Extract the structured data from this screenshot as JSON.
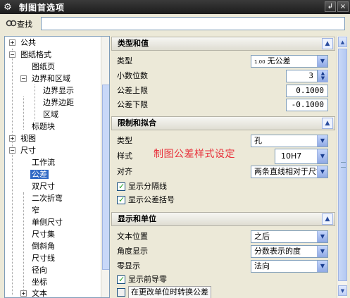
{
  "window": {
    "title": "制图首选项",
    "btn_back": "↲",
    "btn_close": "×"
  },
  "search": {
    "label": "查找",
    "value": ""
  },
  "tree": {
    "items": [
      {
        "label": "公共"
      },
      {
        "label": "图纸格式"
      },
      {
        "label": "图纸页"
      },
      {
        "label": "边界和区域"
      },
      {
        "label": "边界显示"
      },
      {
        "label": "边界边距"
      },
      {
        "label": "区域"
      },
      {
        "label": "标题块"
      },
      {
        "label": "视图"
      },
      {
        "label": "尺寸"
      },
      {
        "label": "工作流"
      },
      {
        "label": "公差"
      },
      {
        "label": "双尺寸"
      },
      {
        "label": "二次折弯"
      },
      {
        "label": "窄"
      },
      {
        "label": "单侧尺寸"
      },
      {
        "label": "尺寸集"
      },
      {
        "label": "倒斜角"
      },
      {
        "label": "尺寸线"
      },
      {
        "label": "径向"
      },
      {
        "label": "坐标"
      },
      {
        "label": "文本"
      }
    ]
  },
  "sections": {
    "type_value": {
      "title": "类型和值",
      "type_label": "类型",
      "type_value": "无公差",
      "type_icon_text": "1.00",
      "decimals_label": "小数位数",
      "decimals_value": "3",
      "upper_label": "公差上限",
      "upper_value": "0.1000",
      "lower_label": "公差下限",
      "lower_value": "-0.1000"
    },
    "limits_fits": {
      "title": "限制和拟合",
      "type_label": "类型",
      "type_value": "孔",
      "style_label": "样式",
      "style_value": "10H7",
      "align_label": "对齐",
      "align_value": "两条直线相对于尺寸",
      "cb_separator": "显示分隔线",
      "cb_brackets": "显示公差括号"
    },
    "display_units": {
      "title": "显示和单位",
      "text_pos_label": "文本位置",
      "text_pos_value": "之后",
      "angle_label": "角度显示",
      "angle_value": "分数表示的度",
      "zero_label": "零显示",
      "zero_value": "法向",
      "cb_leading_zero": "显示前导零",
      "cb_convert": "在更改单位时转换公差"
    }
  },
  "annotation": "制图公差样式设定"
}
